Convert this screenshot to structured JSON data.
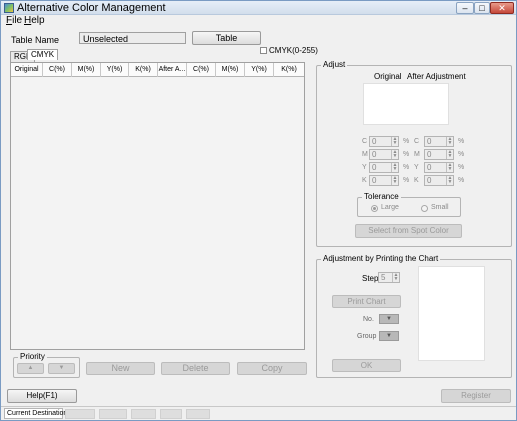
{
  "window": {
    "title": "Alternative Color Management",
    "min_glyph": "–",
    "max_glyph": "□",
    "close_glyph": "✕"
  },
  "menu": {
    "file": {
      "mnemonic": "F",
      "rest": "ile"
    },
    "help": {
      "mnemonic": "H",
      "rest": "elp"
    }
  },
  "header": {
    "table_name_label": "Table Name",
    "table_name_value": "Unselected",
    "table_button": "Table",
    "cmyk_checkbox_label": "CMYK(0-255)"
  },
  "tabs": [
    "RGB",
    "CMYK"
  ],
  "table": {
    "columns": [
      "Original",
      "C(%)",
      "M(%)",
      "Y(%)",
      "K(%)",
      "After A...",
      "C(%)",
      "M(%)",
      "Y(%)",
      "K(%)"
    ]
  },
  "priority": {
    "title": "Priority",
    "up_glyph": "▲",
    "down_glyph": "▼"
  },
  "list_buttons": {
    "new": "New",
    "delete": "Delete",
    "copy": "Copy"
  },
  "adjust": {
    "title": "Adjust",
    "original_label": "Original",
    "after_label": "After Adjustment",
    "original_rows": [
      {
        "channel": "C",
        "value": "0",
        "unit": "%"
      },
      {
        "channel": "M",
        "value": "0",
        "unit": "%"
      },
      {
        "channel": "Y",
        "value": "0",
        "unit": "%"
      },
      {
        "channel": "K",
        "value": "0",
        "unit": "%"
      }
    ],
    "after_rows": [
      {
        "channel": "C",
        "value": "0",
        "unit": "%"
      },
      {
        "channel": "M",
        "value": "0",
        "unit": "%"
      },
      {
        "channel": "Y",
        "value": "0",
        "unit": "%"
      },
      {
        "channel": "K",
        "value": "0",
        "unit": "%"
      }
    ],
    "tolerance": {
      "title": "Tolerance",
      "large": "Large",
      "small": "Small",
      "selected": "Large"
    },
    "spot_color_button": "Select from Spot Color"
  },
  "chart_adjust": {
    "title": "Adjustment by Printing the Chart",
    "step_label": "Step",
    "step_value": "5",
    "print_chart_button": "Print Chart",
    "no_label": "No.",
    "group_label": "Group",
    "ok_button": "OK"
  },
  "footer": {
    "help_button": "Help(F1)",
    "register_button": "Register",
    "current_destination": "Current Destination"
  }
}
